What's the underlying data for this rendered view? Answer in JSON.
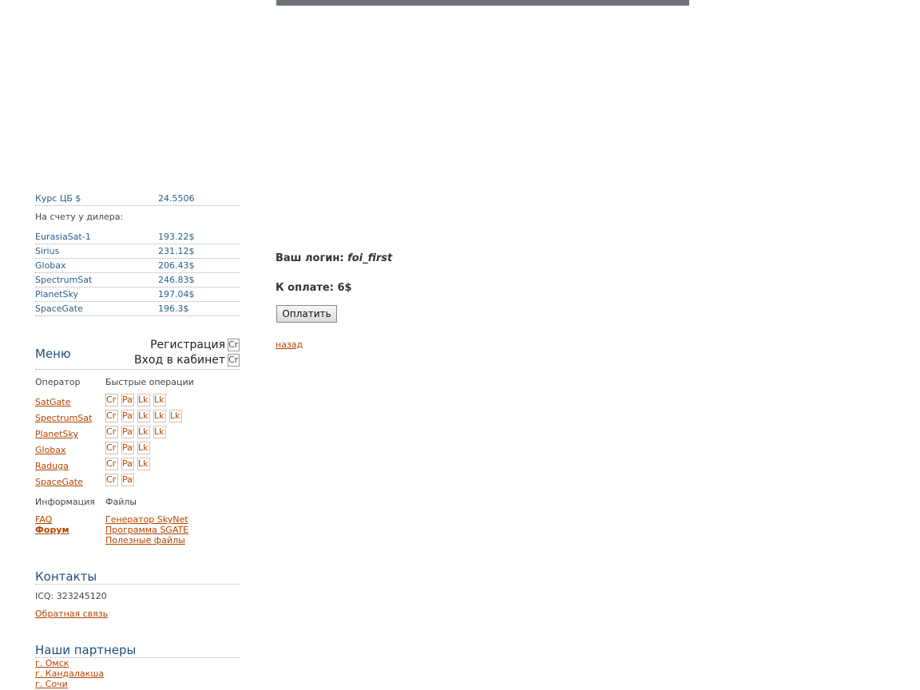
{
  "rates": {
    "cb_label": "Курс ЦБ $",
    "cb_value": "24.5506",
    "dealer_label": "На счету у дилера:",
    "items": [
      {
        "name": "EurasiaSat-1",
        "value": "193.22$"
      },
      {
        "name": "Sirius",
        "value": "231.12$"
      },
      {
        "name": "Globax",
        "value": "206.43$"
      },
      {
        "name": "SpectrumSat",
        "value": "246.83$"
      },
      {
        "name": "PlanetSky",
        "value": "197.04$"
      },
      {
        "name": "SpaceGate",
        "value": "196.3$"
      }
    ]
  },
  "menu": {
    "title": "Меню",
    "register_label": "Регистрация",
    "register_box": "Cr",
    "cabinet_label": "Вход в кабинет",
    "cabinet_box": "Cr",
    "operator_label": "Оператор",
    "quick_label": "Быстрые операции",
    "operators": [
      {
        "name": "SatGate",
        "buttons": [
          "Cr",
          "Pay",
          "Lk",
          "Lk"
        ]
      },
      {
        "name": "SpectrumSat",
        "buttons": [
          "Cr",
          "Pay",
          "Lk",
          "Lk",
          "Lk"
        ]
      },
      {
        "name": "PlanetSky",
        "buttons": [
          "Cr",
          "Pay",
          "Lk",
          "Lk"
        ]
      },
      {
        "name": "Globax",
        "buttons": [
          "Cr",
          "Pay",
          "Lk"
        ]
      },
      {
        "name": "Raduga",
        "buttons": [
          "Cr",
          "Pay",
          "Lk"
        ]
      },
      {
        "name": "SpaceGate",
        "buttons": [
          "Cr",
          "Pay"
        ]
      }
    ],
    "info_label": "Информация",
    "files_label": "Файлы",
    "info_links": [
      "FAQ",
      "Форум"
    ],
    "file_links": [
      "Генератор SkyNet",
      "Программа SGATE",
      "Полезные файлы"
    ]
  },
  "contacts": {
    "title": "Контакты",
    "icq": "ICQ: 323245120",
    "feedback": "Обратная связь"
  },
  "partners": {
    "title": "Наши партнеры",
    "links": [
      "г. Омск",
      "г. Кандалакша",
      "г. Сочи"
    ]
  },
  "main": {
    "login_label": "Ваш логин:",
    "login_value": "foi_first",
    "pay_label": "К оплате:",
    "pay_value": "6$",
    "pay_button": "Оплатить",
    "back_link": "назад"
  }
}
